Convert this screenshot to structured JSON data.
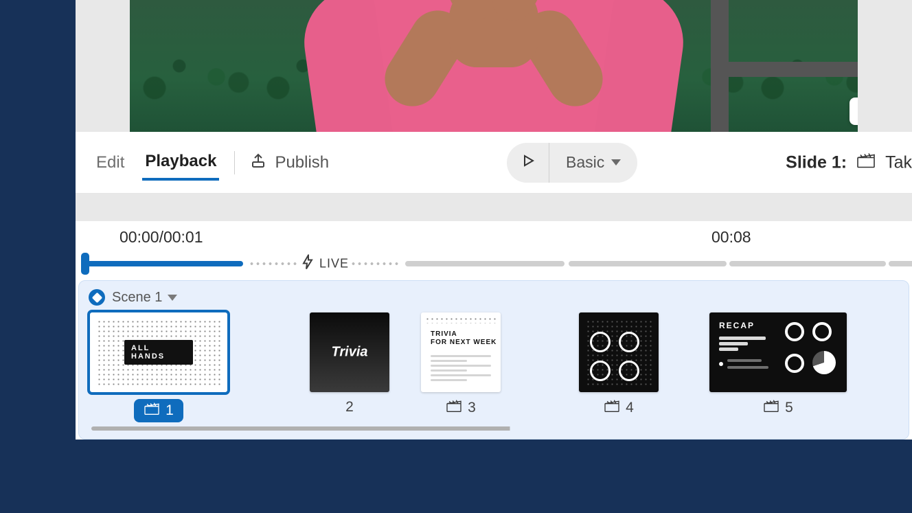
{
  "toolbar": {
    "tabs": {
      "edit": "Edit",
      "playback": "Playback"
    },
    "active_tab": "Playback",
    "publish_label": "Publish",
    "play_mode": "Basic",
    "slide_label": "Slide 1:",
    "take_label": "Tak"
  },
  "timeline": {
    "current_time": "00:00",
    "clip_duration": "00:01",
    "time_separator": " / ",
    "right_time": "00:08",
    "live_label": "LIVE"
  },
  "scene": {
    "selector_label": "Scene 1",
    "selected_index": 1
  },
  "slides": [
    {
      "index": 1,
      "has_clapper": true,
      "caption": "ALL HANDS"
    },
    {
      "index": 2,
      "has_clapper": false,
      "caption": "Trivia"
    },
    {
      "index": 3,
      "has_clapper": true,
      "title": "TRIVIA",
      "subtitle": "FOR NEXT WEEK"
    },
    {
      "index": 4,
      "has_clapper": true
    },
    {
      "index": 5,
      "has_clapper": true,
      "title": "RECAP"
    }
  ],
  "colors": {
    "accent": "#0f6cbd",
    "page_bg": "#173158"
  }
}
